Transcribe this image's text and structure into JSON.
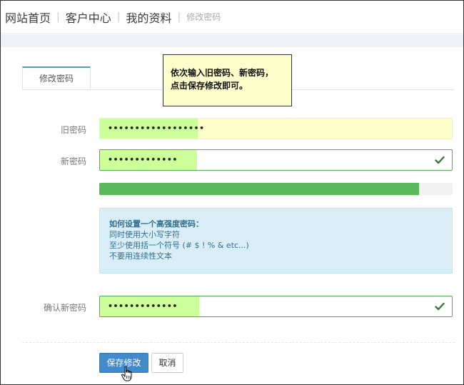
{
  "breadcrumb": {
    "items": [
      "网站首页",
      "客户中心",
      "我的资料"
    ],
    "current": "修改密码"
  },
  "tab": {
    "label": "修改密码"
  },
  "note": {
    "line1": "依次输入旧密码、新密码，",
    "line2": "点击保存修改即可。"
  },
  "form": {
    "old_password": {
      "label": "旧密码",
      "value": "••••••••••••••••••"
    },
    "new_password": {
      "label": "新密码",
      "value": "•••••••••••••"
    },
    "confirm_password": {
      "label": "确认新密码",
      "value": "•••••••••••••"
    }
  },
  "strength": {
    "level_fraction": 0.905
  },
  "tips": {
    "title": "如何设置一个高强度密码：",
    "items": [
      "同时使用大小写字符",
      "至少使用括一个符号 (# $ ! % & etc...)",
      "不要用连续性文本"
    ]
  },
  "buttons": {
    "save": "保存修改",
    "cancel": "取消"
  },
  "colors": {
    "filled_highlight": "#ccff99",
    "field_valid_border": "#4cae4c",
    "check_icon": "#3c763d",
    "progress": "#5cb85c",
    "primary": "#428bca"
  },
  "icons": {
    "valid": "check-icon",
    "pointer": "hand-cursor-icon"
  }
}
